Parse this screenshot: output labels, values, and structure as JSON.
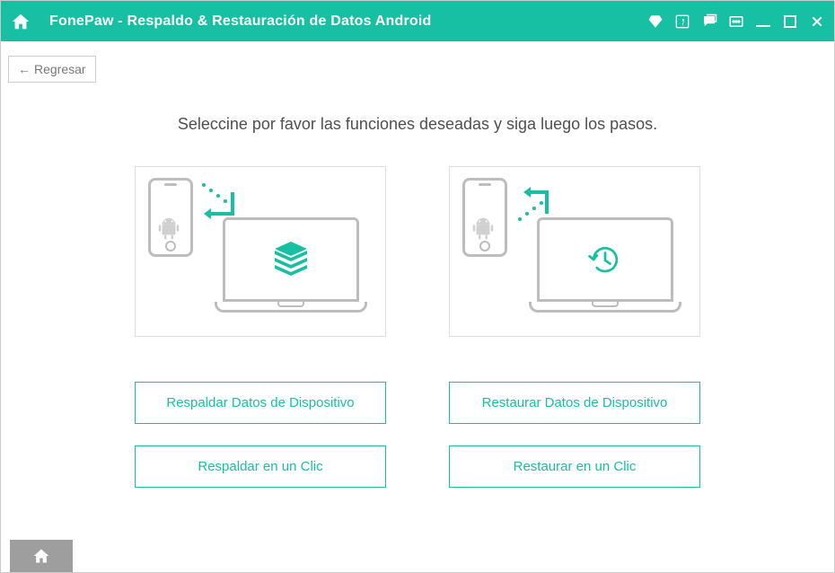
{
  "titlebar": {
    "app_name": "FonePaw",
    "separator": " - ",
    "feature_name": "  Respaldo & Restauración de Datos Android"
  },
  "back_button": {
    "arrow": "←",
    "label": "Regresar"
  },
  "instructions": "Seleccine por favor las funciones deseadas y siga luego los pasos.",
  "buttons": {
    "backup_device": "Respaldar Datos de Dispositivo",
    "backup_one_click": "Respaldar en un Clic",
    "restore_device": "Restaurar Datos de Dispositivo",
    "restore_one_click": "Restaurar en un Clic"
  },
  "colors": {
    "primary": "#17bfa3"
  }
}
